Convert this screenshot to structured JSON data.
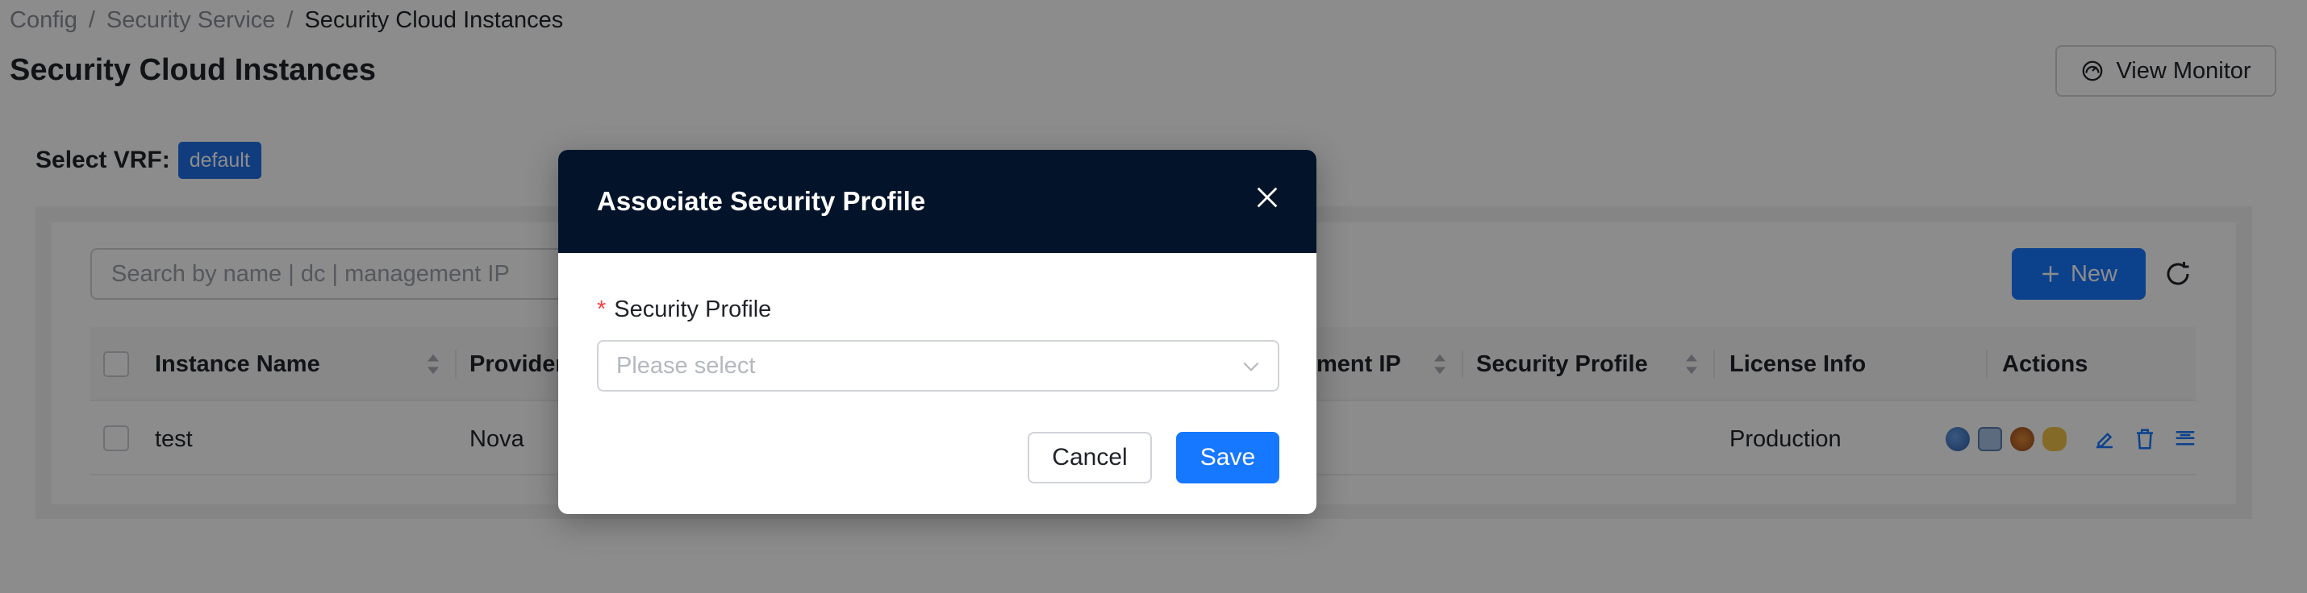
{
  "breadcrumb": {
    "items": [
      "Config",
      "Security Service",
      "Security Cloud Instances"
    ],
    "separator": "/"
  },
  "page": {
    "title": "Security Cloud Instances",
    "view_monitor_label": "View Monitor"
  },
  "vrf": {
    "label": "Select VRF:",
    "value": "default"
  },
  "toolbar": {
    "search_placeholder": "Search by name | dc | management IP",
    "new_label": "New"
  },
  "table": {
    "columns": [
      "Instance Name",
      "Provider",
      "Management IP",
      "Security Profile",
      "License Info",
      "Actions"
    ],
    "visible_header_fragments": {
      "provider": "Provider",
      "management_ip": "ment IP"
    },
    "rows": [
      {
        "instance_name": "test",
        "provider": "Nova",
        "management_ip": "",
        "security_profile": "",
        "license_info": "Production"
      }
    ]
  },
  "modal": {
    "title": "Associate Security Profile",
    "field_label": "Security Profile",
    "required_mark": "*",
    "select_placeholder": "Please select",
    "cancel_label": "Cancel",
    "save_label": "Save"
  },
  "icons": {
    "license": [
      "globe-icon",
      "monitor-icon",
      "bug-icon",
      "badge-icon"
    ],
    "actions": [
      "edit-icon",
      "delete-icon",
      "details-icon"
    ]
  },
  "colors": {
    "primary": "#1677ff",
    "vrf_badge": "#1f6fe8",
    "modal_header": "#03142a",
    "required": "#f53f3f",
    "mask": "rgba(0,0,0,0.45)"
  }
}
